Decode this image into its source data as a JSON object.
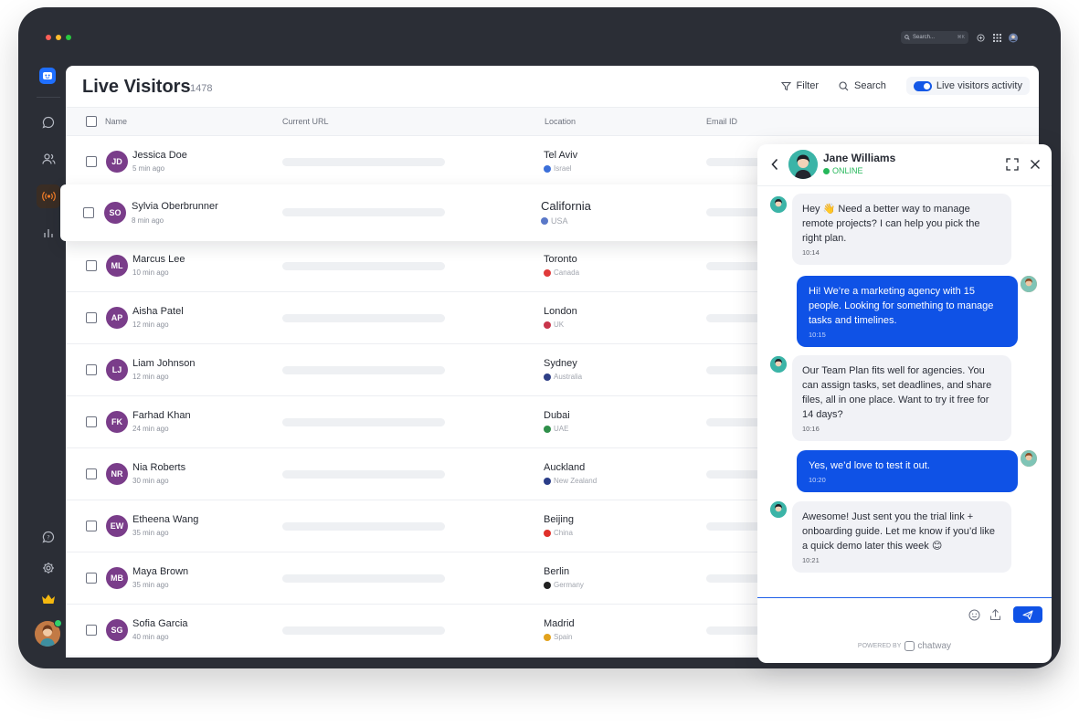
{
  "topbar": {
    "search_placeholder": "Search...",
    "search_shortcut": "⌘K"
  },
  "header": {
    "title": "Live Visitors",
    "count": "1478",
    "filter_label": "Filter",
    "search_label": "Search",
    "toggle_label": "Live visitors activity",
    "toggle_on": true
  },
  "table": {
    "columns": [
      "Name",
      "Current URL",
      "Location",
      "Email ID"
    ],
    "rows": [
      {
        "initials": "JD",
        "name": "Jessica Doe",
        "time": "5 min ago",
        "city": "Tel Aviv",
        "country": "Israel",
        "flag_color": "#3b6fd9"
      },
      {
        "initials": "SO",
        "name": "Sylvia Oberbrunner",
        "time": "8 min ago",
        "city": "California",
        "country": "USA",
        "flag_color": "#5a78c8",
        "highlighted": true
      },
      {
        "initials": "ML",
        "name": "Marcus Lee",
        "time": "10 min ago",
        "city": "Toronto",
        "country": "Canada",
        "flag_color": "#e03a3a"
      },
      {
        "initials": "AP",
        "name": "Aisha Patel",
        "time": "12 min ago",
        "city": "London",
        "country": "UK",
        "flag_color": "#c8344a"
      },
      {
        "initials": "LJ",
        "name": "Liam Johnson",
        "time": "12 min ago",
        "city": "Sydney",
        "country": "Australia",
        "flag_color": "#2e3f86"
      },
      {
        "initials": "FK",
        "name": "Farhad Khan",
        "time": "24 min ago",
        "city": "Dubai",
        "country": "UAE",
        "flag_color": "#2f8f4a"
      },
      {
        "initials": "NR",
        "name": "Nia Roberts",
        "time": "30 min ago",
        "city": "Auckland",
        "country": "New Zealand",
        "flag_color": "#2a3d88"
      },
      {
        "initials": "EW",
        "name": "Etheena Wang",
        "time": "35 min ago",
        "city": "Beijing",
        "country": "China",
        "flag_color": "#e0302a"
      },
      {
        "initials": "MB",
        "name": "Maya Brown",
        "time": "35 min ago",
        "city": "Berlin",
        "country": "Germany",
        "flag_color": "#222222"
      },
      {
        "initials": "SG",
        "name": "Sofia Garcia",
        "time": "40 min ago",
        "city": "Madrid",
        "country": "Spain",
        "flag_color": "#e2a21c"
      }
    ]
  },
  "chat": {
    "agent_name": "Jane Williams",
    "status": "ONLINE",
    "messages": [
      {
        "from": "agent",
        "text": "Hey 👋 Need a better way to manage remote projects? I can help you pick the right plan.",
        "time": "10:14"
      },
      {
        "from": "user",
        "text": "Hi! We’re a marketing agency with 15 people. Looking for something to manage tasks and timelines.",
        "time": "10:15"
      },
      {
        "from": "agent",
        "text": "Our Team Plan fits well for agencies. You can assign tasks, set deadlines, and share files, all in one place. Want to try it free for 14 days?",
        "time": "10:16"
      },
      {
        "from": "user",
        "text": "Yes, we’d love to test it out.",
        "time": "10:20"
      },
      {
        "from": "agent",
        "text": "Awesome! Just sent you the trial link + onboarding guide. Let me know if you’d like a quick demo later this week 😊",
        "time": "10:21"
      }
    ],
    "powered_by": "POWERED BY",
    "brand": "chatway"
  },
  "colors": {
    "frame": "#2b2e36",
    "accent": "#0f52e6",
    "avatar": "#7a3d8a",
    "online": "#25b75a"
  },
  "icons": [
    "chat-icon",
    "users-icon",
    "broadcast-icon",
    "analytics-icon",
    "help-icon",
    "settings-icon",
    "crown-icon",
    "filter-icon",
    "search-icon",
    "back-icon",
    "expand-icon",
    "close-icon",
    "emoji-icon",
    "upload-icon",
    "send-icon"
  ]
}
